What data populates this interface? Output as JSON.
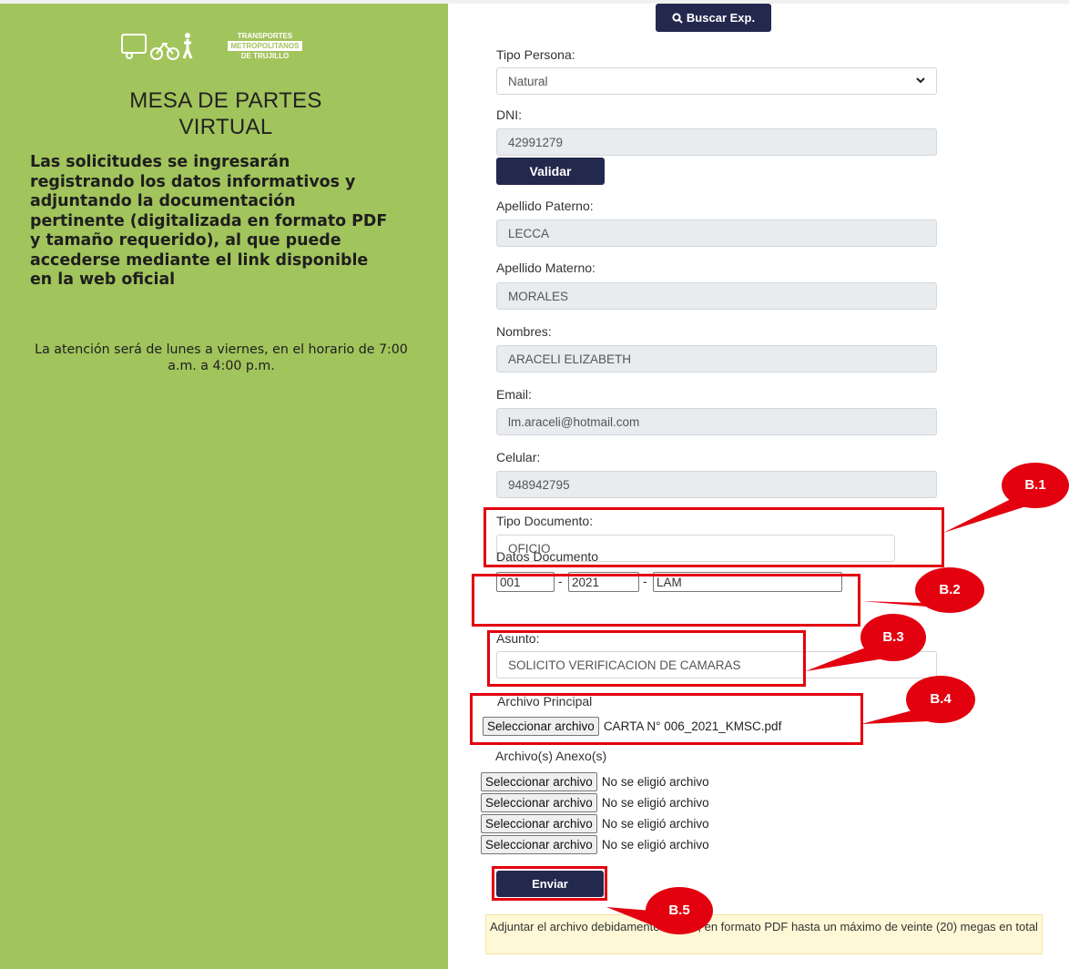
{
  "sidebar": {
    "logo_line1": "TRANSPORTES",
    "logo_line2": "METROPOLITANOS",
    "logo_line3": "DE TRUJILLO",
    "title_line1": "MESA DE PARTES",
    "title_line2": "VIRTUAL",
    "description": "Las solicitudes se ingresarán registrando los datos informativos y adjuntando la documentación pertinente (digitalizada en formato PDF y tamaño requerido), al que puede accederse mediante el link disponible en la web oficial",
    "hours": "La atención será de lunes a viernes, en el horario de 7:00 a.m. a 4:00 p.m."
  },
  "header": {
    "search_button": "Buscar Exp."
  },
  "form": {
    "tipo_persona": {
      "label": "Tipo Persona:",
      "value": "Natural"
    },
    "dni": {
      "label": "DNI:",
      "value": "42991279",
      "validate_button": "Validar"
    },
    "apellido_paterno": {
      "label": "Apellido Paterno:",
      "value": "LECCA"
    },
    "apellido_materno": {
      "label": "Apellido Materno:",
      "value": "MORALES"
    },
    "nombres": {
      "label": "Nombres:",
      "value": "ARACELI ELIZABETH"
    },
    "email": {
      "label": "Email:",
      "value": "lm.araceli@hotmail.com"
    },
    "celular": {
      "label": "Celular:",
      "value": "948942795"
    },
    "tipo_documento": {
      "label": "Tipo Documento:",
      "value": "OFICIO"
    },
    "datos_documento": {
      "label": "Datos Documento",
      "numero": "001",
      "anio": "2021",
      "siglas": "LAM",
      "separator": "-"
    },
    "asunto": {
      "label": "Asunto:",
      "value": "SOLICITO VERIFICACION DE CAMARAS"
    },
    "archivo_principal": {
      "label": "Archivo Principal",
      "button": "Seleccionar archivo",
      "filename": "CARTA N° 006_2021_KMSC.pdf"
    },
    "archivos_anexos": {
      "label": "Archivo(s) Anexo(s)",
      "items": [
        {
          "button": "Seleccionar archivo",
          "filename": "No se eligió archivo"
        },
        {
          "button": "Seleccionar archivo",
          "filename": "No se eligió archivo"
        },
        {
          "button": "Seleccionar archivo",
          "filename": "No se eligió archivo"
        },
        {
          "button": "Seleccionar archivo",
          "filename": "No se eligió archivo"
        }
      ]
    },
    "submit_button": "Enviar",
    "notice": "Adjuntar el archivo debidamente foliado, en formato PDF hasta un máximo de veinte (20) megas en total"
  },
  "annotations": {
    "b1": "B.1",
    "b2": "B.2",
    "b3": "B.3",
    "b4": "B.4",
    "b5": "B.5",
    "color": "#e3000f"
  },
  "colors": {
    "sidebar": "#a2c45c",
    "button": "#23284d",
    "notice_bg": "#fff8d6"
  }
}
